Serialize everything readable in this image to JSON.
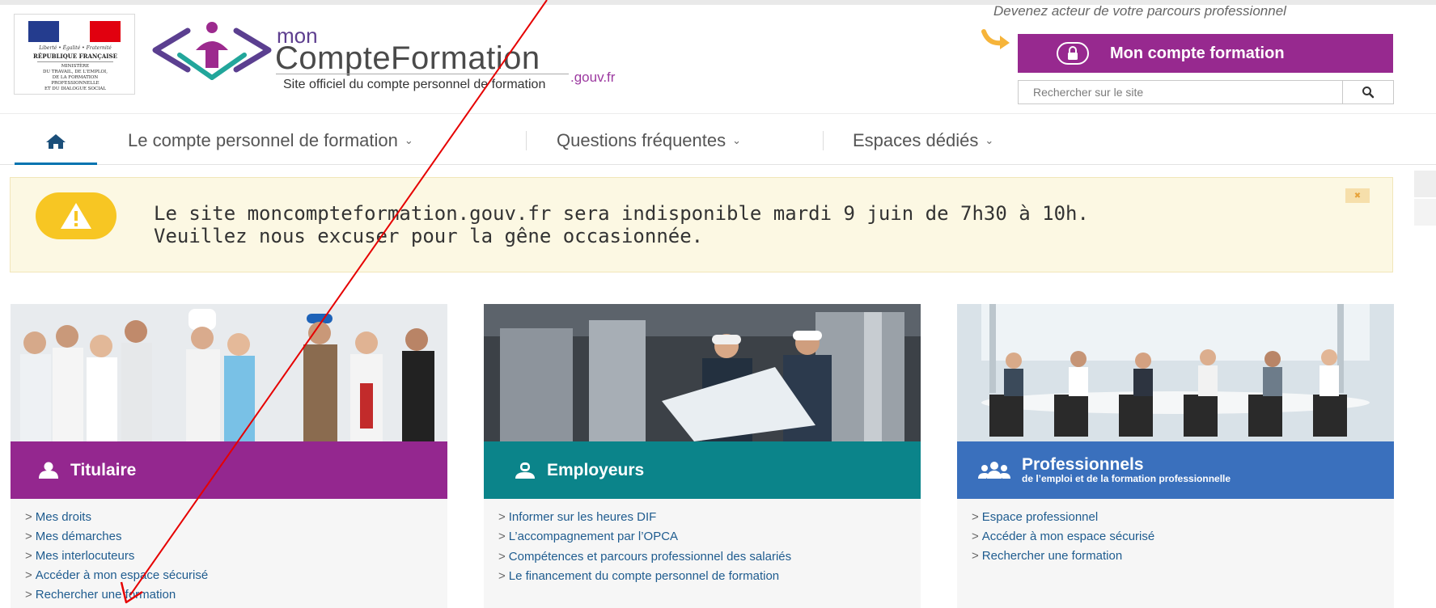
{
  "header": {
    "republic_motto": "Liberté • Égalité • Fraternité",
    "republic_name": "RÉPUBLIQUE FRANÇAISE",
    "ministry_lines": [
      "MINISTÈRE",
      "DU TRAVAIL, DE L'EMPLOI,",
      "DE LA FORMATION",
      "PROFESSIONNELLE",
      "ET DU DIALOGUE SOCIAL"
    ],
    "logo_mon": "mon",
    "logo_name": "CompteFormation",
    "logo_domain": ".gouv.fr",
    "logo_tagline": "Site officiel du compte personnel de formation",
    "slogan": "Devenez acteur de votre parcours professionnel",
    "account_button_label": "Mon compte formation",
    "search_placeholder": "Rechercher sur le site"
  },
  "nav": {
    "home_icon": "home-icon",
    "items": [
      {
        "label": "Le compte personnel de formation"
      },
      {
        "label": "Questions fréquentes"
      },
      {
        "label": "Espaces dédiés"
      }
    ]
  },
  "alert": {
    "icon": "warning-icon",
    "line1": "Le site moncompteformation.gouv.fr sera indisponible mardi 9 juin de 7h30 à 10h.",
    "line2": "Veuillez nous excuser pour la gêne occasionnée.",
    "close_icon": "close-icon"
  },
  "cards": [
    {
      "title": "Titulaire",
      "icon": "user-icon",
      "color": "#94278f",
      "links": [
        "Mes droits",
        "Mes démarches",
        "Mes interlocuteurs",
        "Accéder à mon espace sécurisé",
        "Rechercher une formation"
      ]
    },
    {
      "title": "Employeurs",
      "icon": "employer-icon",
      "color": "#0b848a",
      "links": [
        "Informer sur les heures DIF",
        "L’accompagnement par l’OPCA",
        "Compétences et parcours professionnel des salariés",
        "Le financement du compte personnel de formation"
      ]
    },
    {
      "title": "Professionnels",
      "subtitle": "de l’emploi et de la formation professionnelle",
      "icon": "group-icon",
      "color": "#3a70bd",
      "links": [
        "Espace professionnel",
        "Accéder à mon espace sécurisé",
        "Rechercher une formation"
      ]
    }
  ],
  "colors": {
    "brand_purple": "#97298f",
    "teal": "#0b848a",
    "blue": "#3a70bd",
    "alert_bg": "#fcf8e3",
    "warning_yellow": "#f7c623",
    "link": "#1f5c8f",
    "annotation_arrow": "#e60000"
  }
}
